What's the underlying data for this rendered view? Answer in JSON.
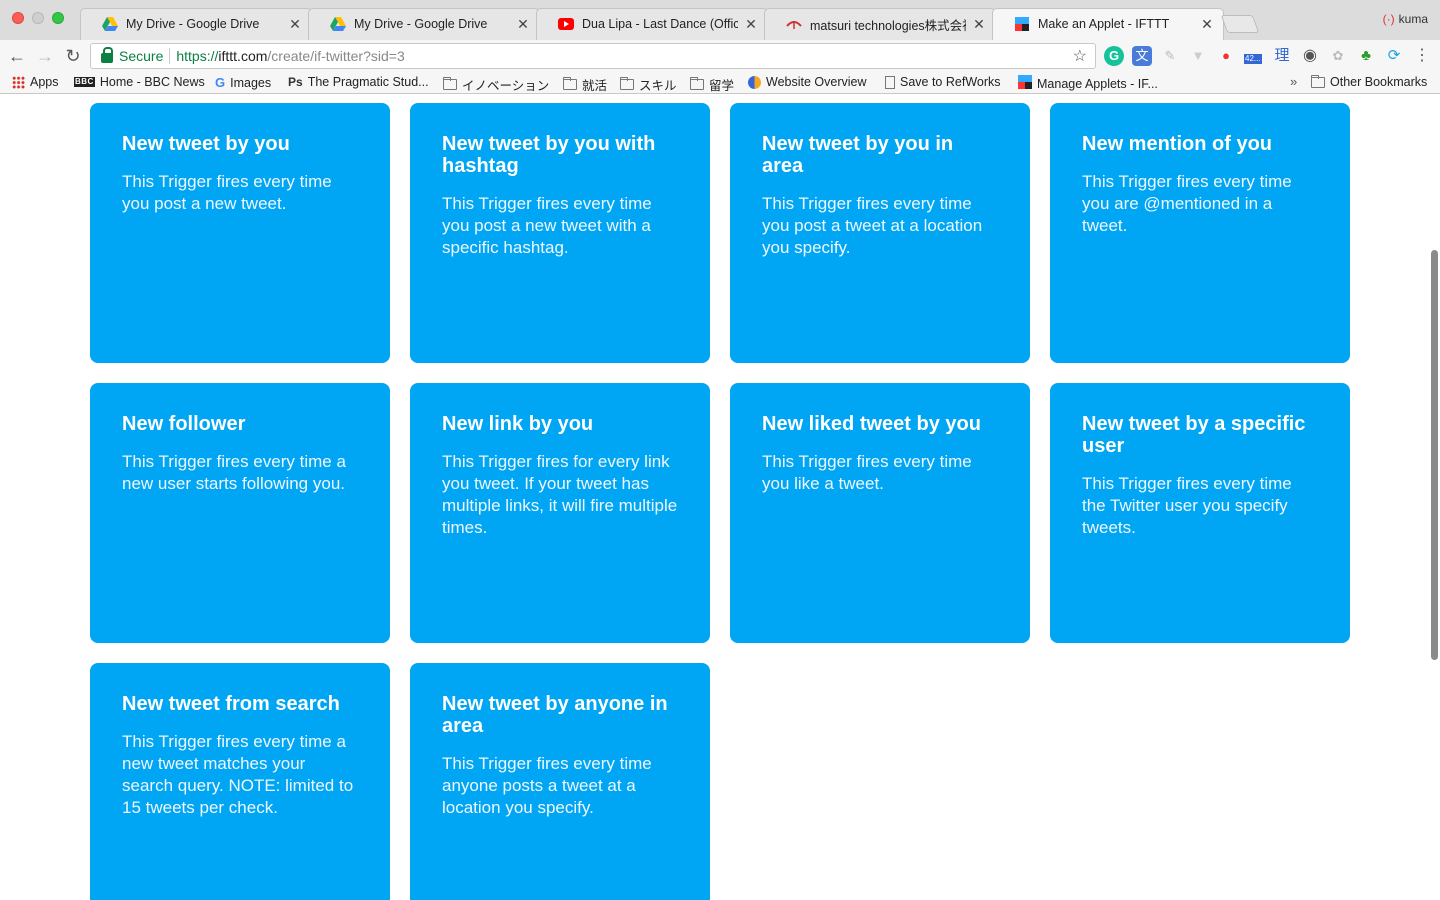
{
  "browser": {
    "tabs": [
      {
        "title": "My Drive - Google Drive",
        "icon": "google-drive-icon"
      },
      {
        "title": "My Drive - Google Drive",
        "icon": "google-drive-icon"
      },
      {
        "title": "Dua Lipa - Last Dance (Official",
        "icon": "youtube-icon"
      },
      {
        "title": "matsuri technologies株式会社",
        "icon": "matsuri-icon"
      },
      {
        "title": "Make an Applet - IFTTT",
        "icon": "ifttt-icon",
        "active": true
      }
    ],
    "profile_name": "kuma",
    "address": {
      "secure_label": "Secure",
      "scheme": "https://",
      "host": "ifttt.com",
      "path": "/create/if-twitter?sid=3"
    },
    "extension_badge": "42...",
    "extension_kanji": "理",
    "bookmarks": [
      {
        "label": "Apps",
        "icon": "apps-grid-icon"
      },
      {
        "label": "Home - BBC News",
        "icon": "bbc-icon"
      },
      {
        "label": "Images",
        "icon": "google-icon"
      },
      {
        "label": "The Pragmatic Stud...",
        "icon": "pragmatic-icon"
      },
      {
        "label": "イノベーション",
        "icon": "folder-icon"
      },
      {
        "label": "就活",
        "icon": "folder-icon"
      },
      {
        "label": "スキル",
        "icon": "folder-icon"
      },
      {
        "label": "留学",
        "icon": "folder-icon"
      },
      {
        "label": "Website Overview",
        "icon": "website-overview-icon"
      },
      {
        "label": "Save to RefWorks",
        "icon": "page-icon"
      },
      {
        "label": "Manage Applets - IF...",
        "icon": "ifttt-icon"
      }
    ],
    "other_bookmarks": "Other Bookmarks",
    "overflow": "»"
  },
  "triggers": [
    {
      "title": "New tweet by you",
      "desc": "This Trigger fires every time you post a new tweet."
    },
    {
      "title": "New tweet by you with hashtag",
      "desc": "This Trigger fires every time you post a new tweet with a specific hashtag."
    },
    {
      "title": "New tweet by you in area",
      "desc": "This Trigger fires every time you post a tweet at a location you specify."
    },
    {
      "title": "New mention of you",
      "desc": "This Trigger fires every time you are @mentioned in a tweet."
    },
    {
      "title": "New follower",
      "desc": "This Trigger fires every time a new user starts following you."
    },
    {
      "title": "New link by you",
      "desc": "This Trigger fires for every link you tweet. If your tweet has multiple links, it will fire multiple times."
    },
    {
      "title": "New liked tweet by you",
      "desc": "This Trigger fires every time you like a tweet."
    },
    {
      "title": "New tweet by a specific user",
      "desc": "This Trigger fires every time the Twitter user you specify tweets."
    },
    {
      "title": "New tweet from search",
      "desc": "This Trigger fires every time a new tweet matches your search query. NOTE: limited to 15 tweets per check."
    },
    {
      "title": "New tweet by anyone in area",
      "desc": "This Trigger fires every time anyone posts a tweet at a location you specify."
    }
  ],
  "colors": {
    "card": "#00a5f3",
    "secure": "#0b8043"
  }
}
